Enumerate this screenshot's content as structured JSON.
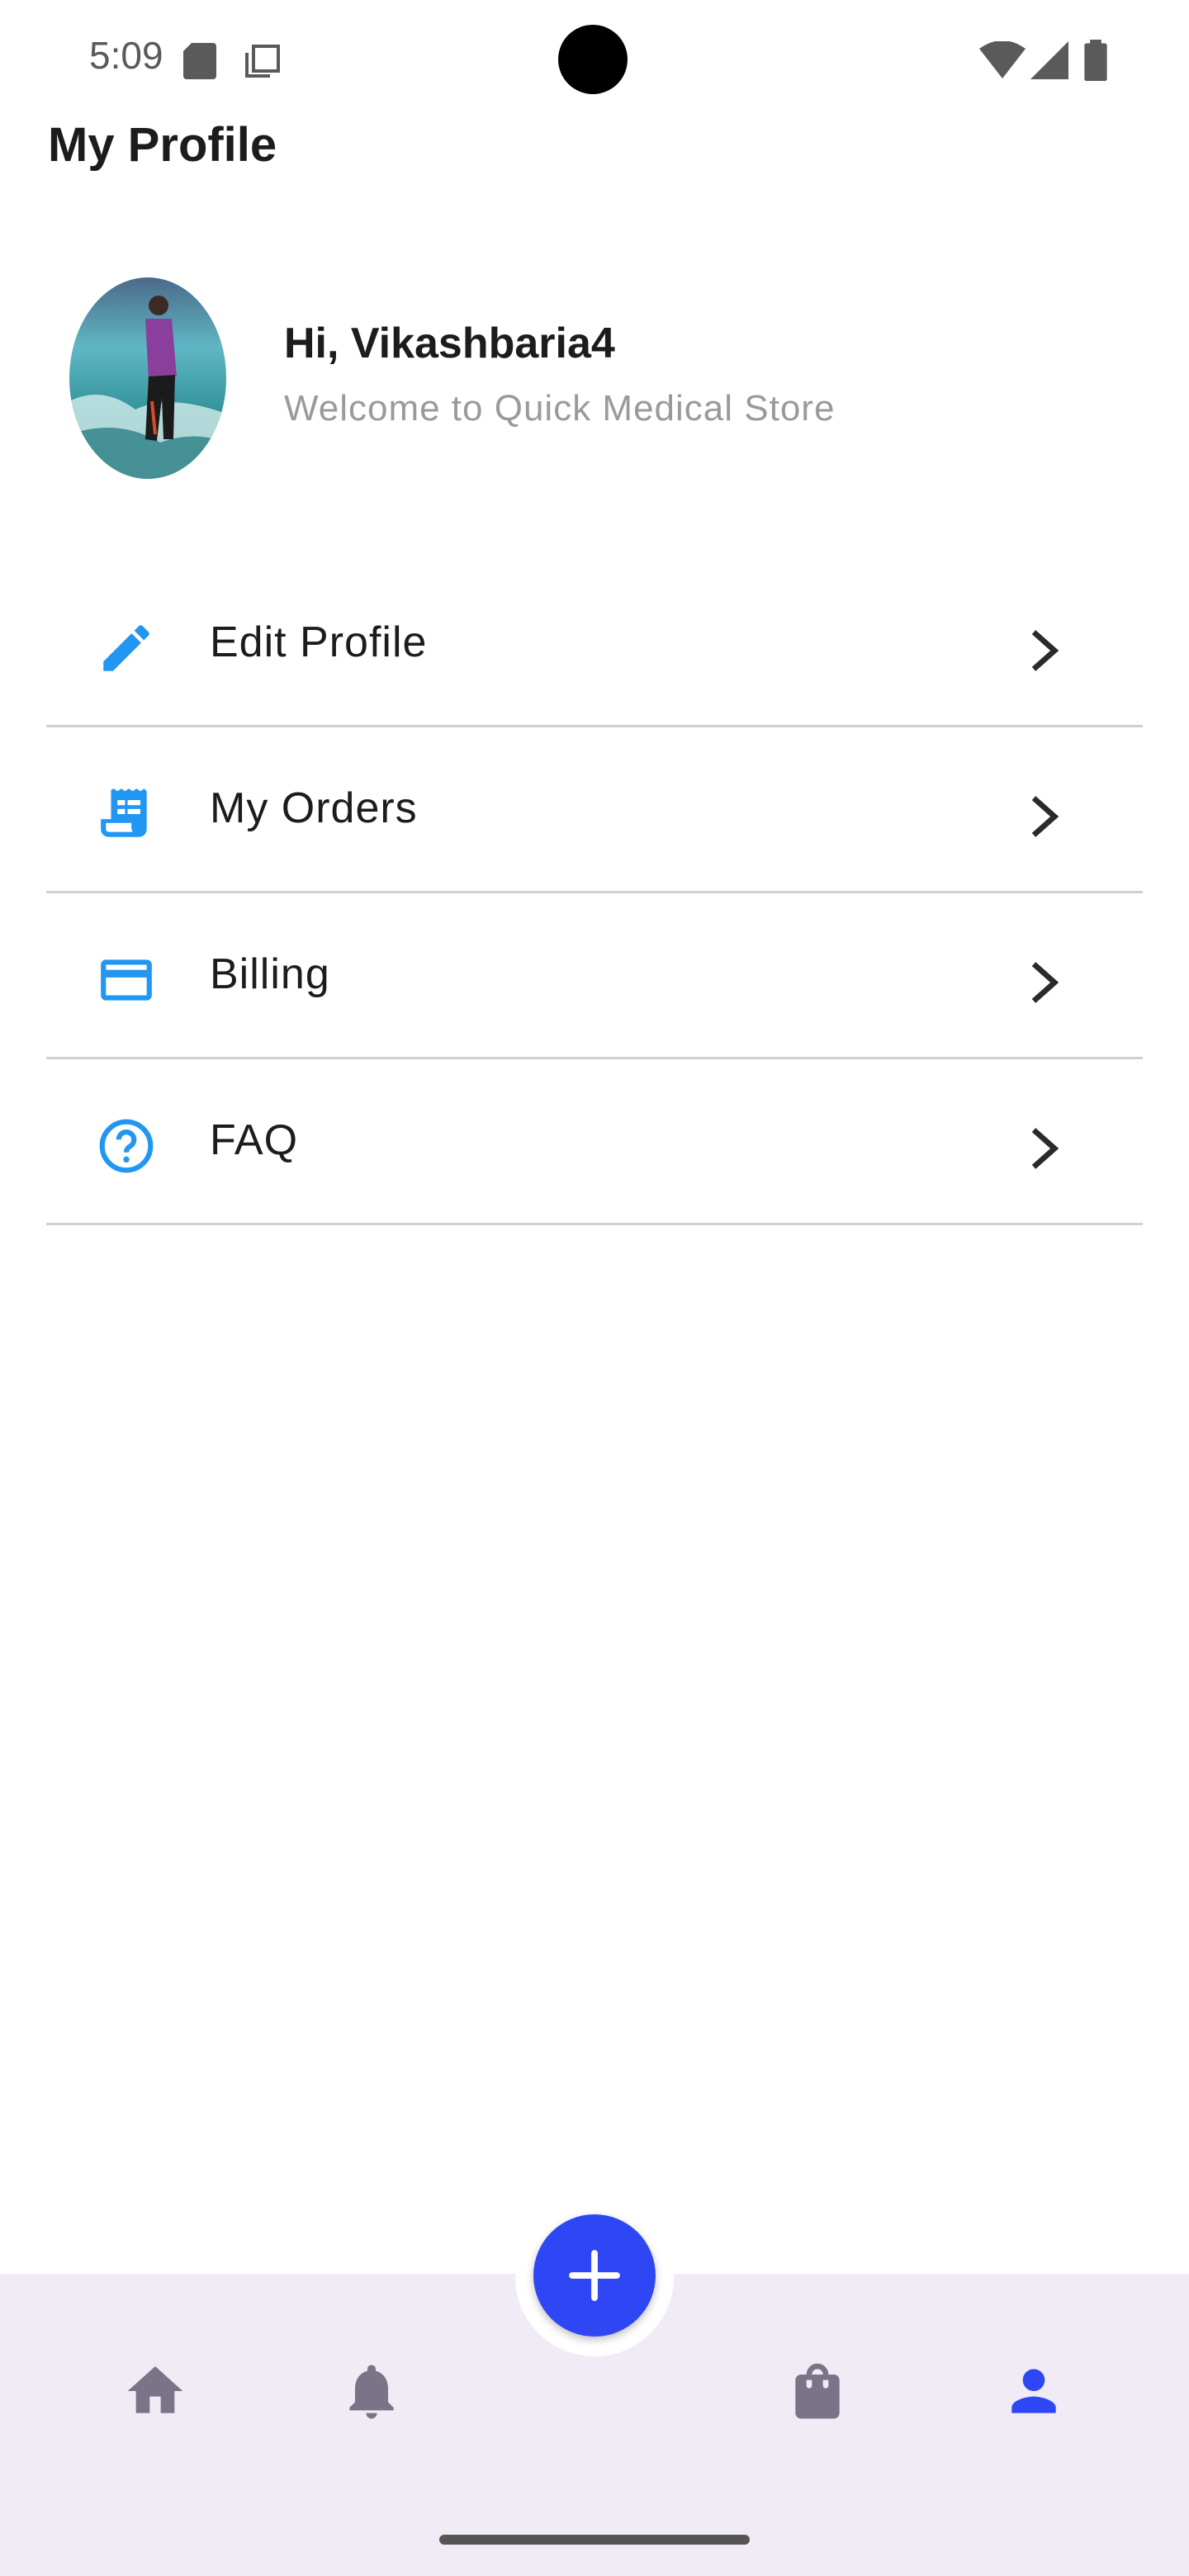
{
  "status_bar": {
    "time": "5:09",
    "icons": [
      "sd-card-icon",
      "copy-icon",
      "wifi-icon",
      "signal-icon",
      "battery-icon"
    ]
  },
  "page": {
    "title": "My Profile"
  },
  "profile": {
    "greeting": "Hi, Vikashbaria4",
    "subtitle": "Welcome to Quick Medical Store"
  },
  "menu": {
    "items": [
      {
        "label": "Edit Profile",
        "icon": "pencil-icon"
      },
      {
        "label": "My Orders",
        "icon": "receipt-icon"
      },
      {
        "label": "Billing",
        "icon": "credit-card-icon"
      },
      {
        "label": "FAQ",
        "icon": "help-circle-icon"
      }
    ]
  },
  "bottom_nav": {
    "items": [
      {
        "icon": "home-icon",
        "active": false
      },
      {
        "icon": "bell-icon",
        "active": false
      },
      {
        "icon": "shopping-bag-icon",
        "active": false
      },
      {
        "icon": "person-icon",
        "active": true
      }
    ],
    "fab_icon": "plus-icon"
  },
  "colors": {
    "accent": "#2196F3",
    "fab": "#2f46f4",
    "nav_background": "#f1ebf5",
    "nav_inactive": "#7a7489",
    "nav_active": "#2f46f4"
  }
}
